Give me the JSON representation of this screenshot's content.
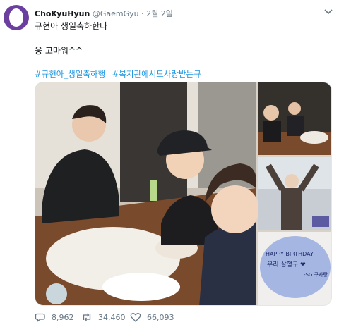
{
  "tweet": {
    "display_name": "ChoKyuHyun",
    "handle": "@GaemGyu",
    "separator": "·",
    "date": "2월 2일",
    "line1": "규현아 생일축하한다",
    "line2": "웅 고마워^^",
    "hashtags": [
      "#규현아_생일축하행",
      "#복지관에서도사랑받는규"
    ]
  },
  "media": {
    "cake_text": {
      "line1": "HAPPY BIRTHDAY",
      "line2": "우리 삼행구 ❤",
      "line3": "-SG 구사랑"
    }
  },
  "counts": {
    "replies": "8,962",
    "retweets": "34,460",
    "likes": "66,093"
  },
  "colors": {
    "avatar": "#6a3fa0",
    "link": "#1b95e0",
    "muted": "#657786"
  },
  "icons": [
    "chevron-down-icon",
    "reply-icon",
    "retweet-icon",
    "heart-icon"
  ]
}
